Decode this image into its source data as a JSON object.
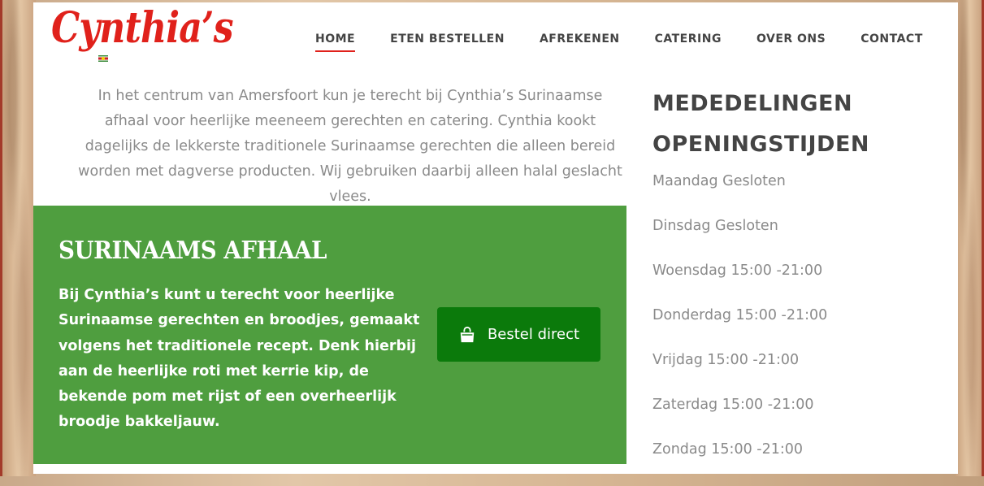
{
  "header": {
    "logo_text": "Cynthia’s",
    "nav": [
      {
        "label": "HOME",
        "active": true
      },
      {
        "label": "ETEN BESTELLEN",
        "active": false
      },
      {
        "label": "AFREKENEN",
        "active": false
      },
      {
        "label": "CATERING",
        "active": false
      },
      {
        "label": "OVER ONS",
        "active": false
      },
      {
        "label": "CONTACT",
        "active": false
      }
    ]
  },
  "intro": {
    "text": "In het centrum van Amersfoort kun je terecht bij Cynthia’s Surinaamse afhaal voor heerlijke meeneem gerechten en catering. Cynthia kookt dagelijks de lekkerste traditionele Surinaamse gerechten die alleen bereid worden met dagverse producten. Wij gebruiken daarbij alleen halal geslacht vlees."
  },
  "promo": {
    "title": "SURINAAMS AFHAAL",
    "body": "Bij Cynthia’s kunt u terecht voor heerlijke Surinaamse gerechten en broodjes, gemaakt volgens het traditionele recept. Denk hierbij aan de heerlijke roti met kerrie kip, de bekende pom met rijst of een overheerlijk broodje bakkeljauw.",
    "button_label": "Bestel direct",
    "button_icon": "shopping-bag-icon",
    "bg_color": "#4f9e3f",
    "button_color": "#0b7a0b"
  },
  "sidebar": {
    "heading1": "MEDEDELINGEN",
    "heading2": "OPENINGSTIJDEN",
    "hours": [
      "Maandag Gesloten",
      "Dinsdag Gesloten",
      "Woensdag 15:00 -21:00",
      "Donderdag 15:00 -21:00",
      "Vrijdag 15:00 -21:00",
      "Zaterdag 15:00 -21:00",
      "Zondag 15:00 -21:00"
    ]
  },
  "colors": {
    "brand_red": "#e0211b",
    "text_gray": "#8a8a8a",
    "heading_dark": "#444444"
  }
}
